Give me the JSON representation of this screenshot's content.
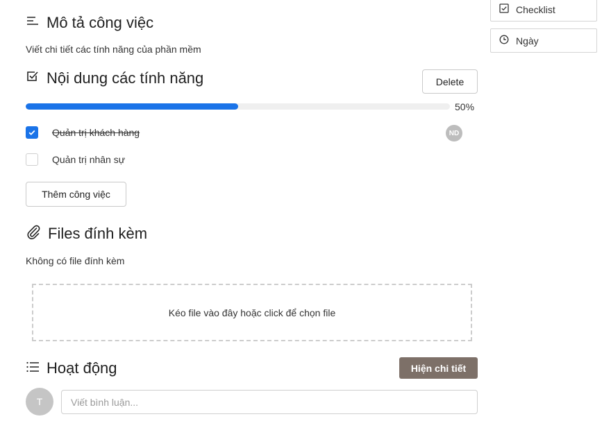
{
  "sidebar": {
    "checklist_label": "Checklist",
    "date_label": "Ngày"
  },
  "description": {
    "title": "Mô tả công việc",
    "text": "Viết chi tiết các tính năng của phần mềm"
  },
  "checklist": {
    "title": "Nội dung các tính năng",
    "delete_label": "Delete",
    "progress_percent": 50,
    "progress_label": "50%",
    "items": [
      {
        "label": "Quản trị khách hàng",
        "checked": true,
        "assignee": "ND"
      },
      {
        "label": "Quản trị nhân sự",
        "checked": false
      }
    ],
    "add_label": "Thêm công việc"
  },
  "attachments": {
    "title": "Files đính kèm",
    "empty_text": "Không có file đính kèm",
    "dropzone_text": "Kéo file vào đây hoặc click để chọn file"
  },
  "activity": {
    "title": "Hoạt động",
    "show_details_label": "Hiện chi tiết",
    "avatar_initial": "T",
    "comment_placeholder": "Viết bình luận..."
  },
  "colors": {
    "accent": "#1a73e8",
    "dark_button": "#7d7068"
  }
}
